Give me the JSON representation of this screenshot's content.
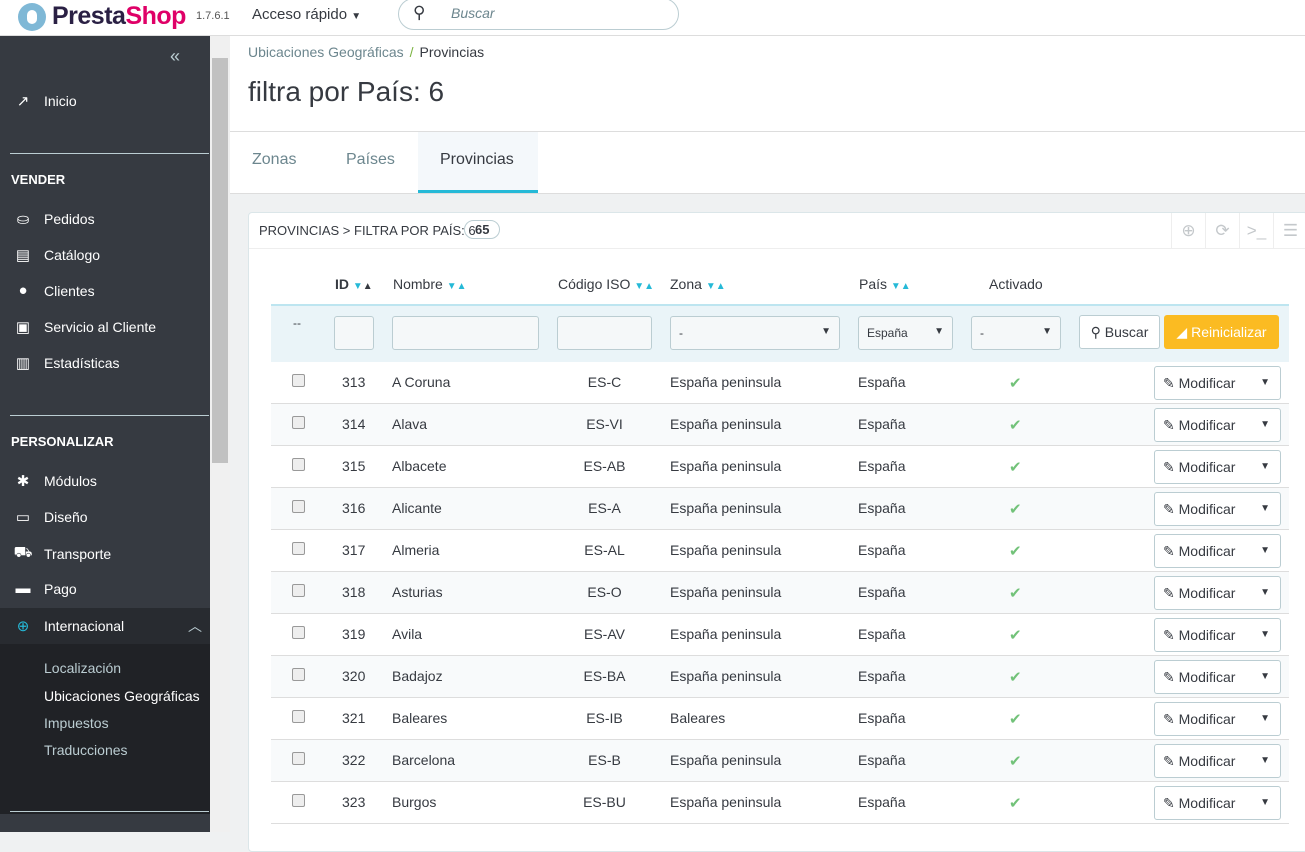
{
  "top": {
    "brand_a": "Presta",
    "brand_b": "Shop",
    "version": "1.7.6.1",
    "quick_access": "Acceso rápido",
    "search_placeholder": "Buscar"
  },
  "sidebar": {
    "inicio": "Inicio",
    "vender": "VENDER",
    "vender_items": [
      "Pedidos",
      "Catálogo",
      "Clientes",
      "Servicio al Cliente",
      "Estadísticas"
    ],
    "personalizar": "PERSONALIZAR",
    "personalizar_items": [
      "Módulos",
      "Diseño",
      "Transporte",
      "Pago",
      "Internacional"
    ],
    "sub_items": [
      "Localización",
      "Ubicaciones Geográficas",
      "Impuestos",
      "Traducciones"
    ]
  },
  "breadcrumb": {
    "parent": "Ubicaciones Geográficas",
    "current": "Provincias"
  },
  "page_title": "filtra por País: 6",
  "tabs": [
    "Zonas",
    "Países",
    "Provincias"
  ],
  "panel": {
    "title": "PROVINCIAS > FILTRA POR PAÍS: 6",
    "count": "65"
  },
  "columns": [
    "ID",
    "Nombre",
    "Código ISO",
    "Zona",
    "País",
    "Activado"
  ],
  "filters": {
    "dash": "--",
    "zona": "-",
    "pais": "España",
    "activado": "-",
    "search": "Buscar",
    "reset": "Reinicializar"
  },
  "edit_label": "Modificar",
  "rows": [
    [
      "313",
      "A Coruna",
      "ES-C",
      "España peninsula",
      "España"
    ],
    [
      "314",
      "Alava",
      "ES-VI",
      "España peninsula",
      "España"
    ],
    [
      "315",
      "Albacete",
      "ES-AB",
      "España peninsula",
      "España"
    ],
    [
      "316",
      "Alicante",
      "ES-A",
      "España peninsula",
      "España"
    ],
    [
      "317",
      "Almeria",
      "ES-AL",
      "España peninsula",
      "España"
    ],
    [
      "318",
      "Asturias",
      "ES-O",
      "España peninsula",
      "España"
    ],
    [
      "319",
      "Avila",
      "ES-AV",
      "España peninsula",
      "España"
    ],
    [
      "320",
      "Badajoz",
      "ES-BA",
      "España peninsula",
      "España"
    ],
    [
      "321",
      "Baleares",
      "ES-IB",
      "Baleares",
      "España"
    ],
    [
      "322",
      "Barcelona",
      "ES-B",
      "España peninsula",
      "España"
    ],
    [
      "323",
      "Burgos",
      "ES-BU",
      "España peninsula",
      "España"
    ]
  ]
}
